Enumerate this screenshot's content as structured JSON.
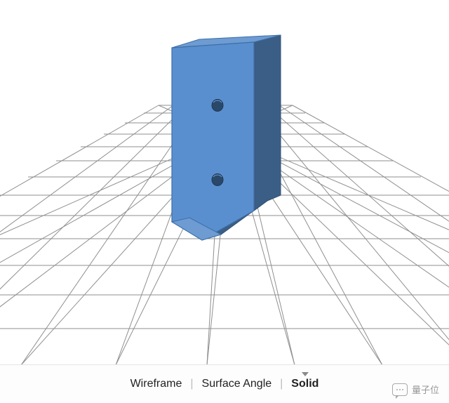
{
  "viewport": {
    "grid_color": "#999999",
    "background": "#ffffff",
    "model": {
      "type": "angle-bracket",
      "face_color": "#5a8fcf",
      "edge_color": "#3c6fa8",
      "shadow_color": "#3b5e86",
      "hole_count": 2
    }
  },
  "toolbar": {
    "modes": [
      {
        "id": "wireframe",
        "label": "Wireframe",
        "selected": false
      },
      {
        "id": "surface-angle",
        "label": "Surface Angle",
        "selected": false
      },
      {
        "id": "solid",
        "label": "Solid",
        "selected": true
      }
    ]
  },
  "watermark": {
    "text": "量子位"
  }
}
